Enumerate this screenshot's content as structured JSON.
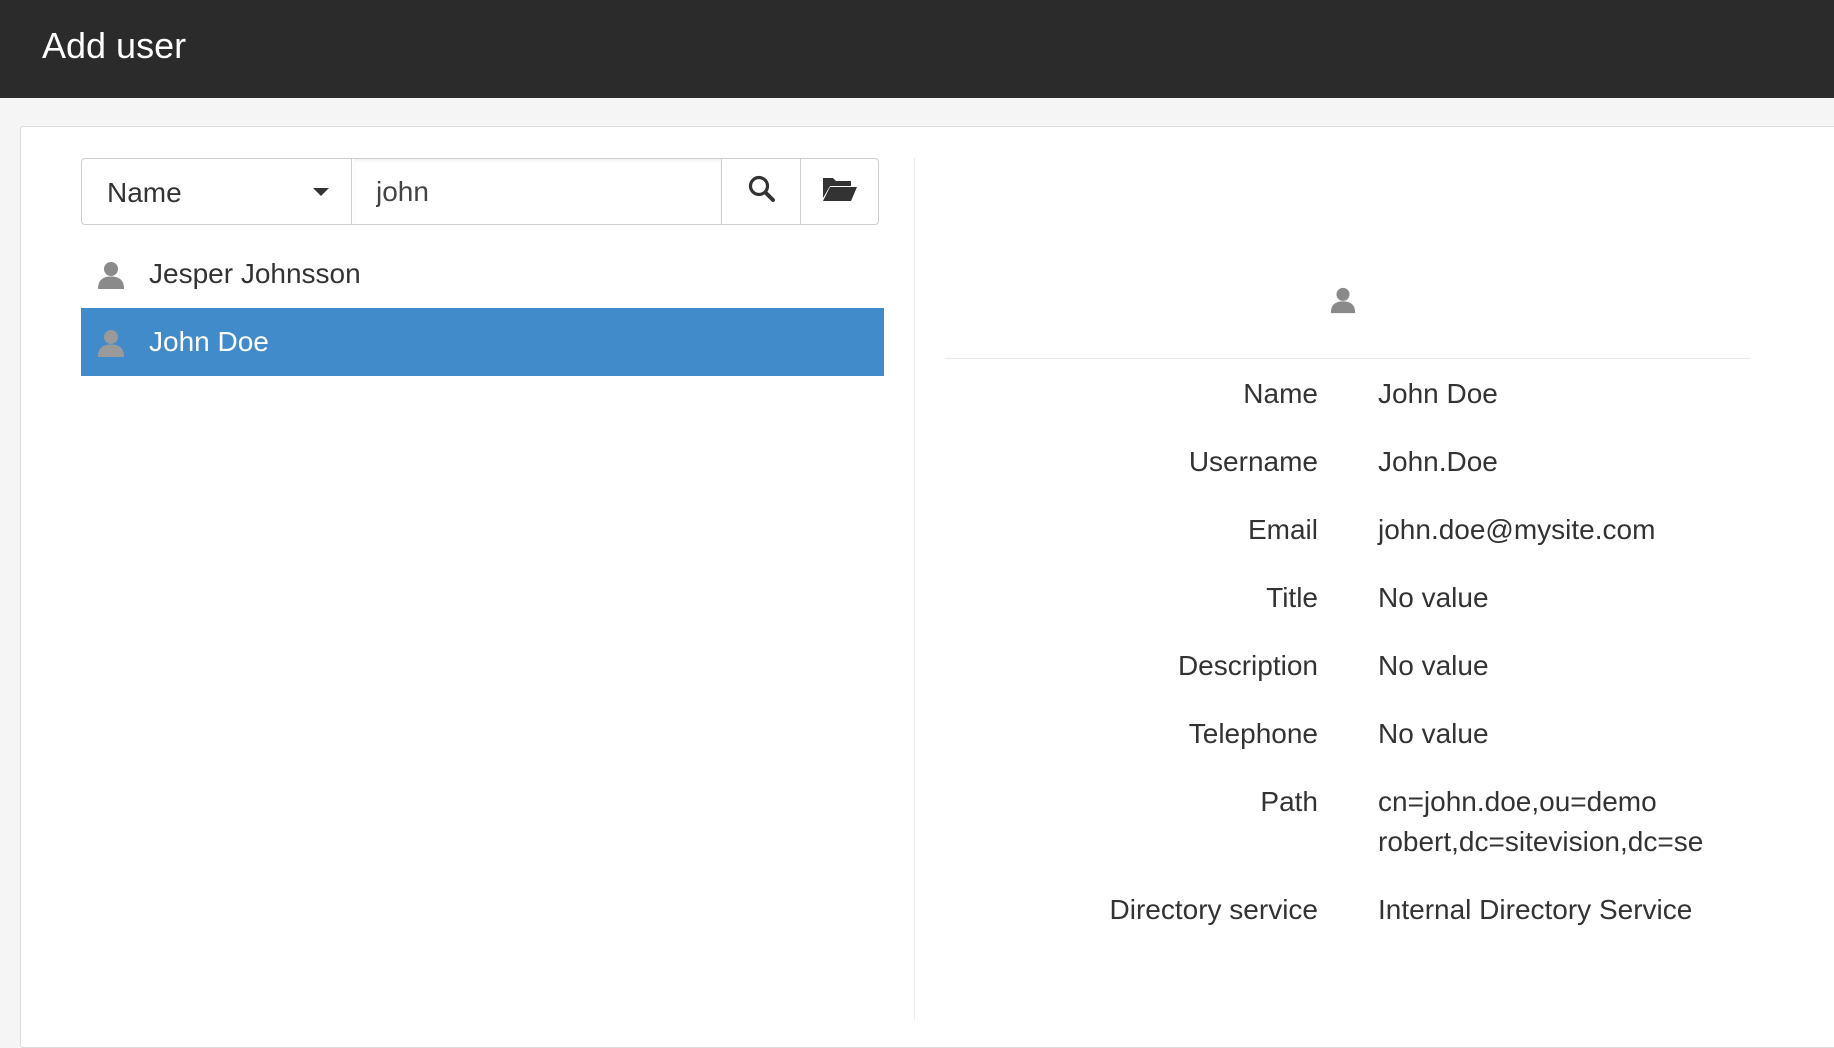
{
  "header": {
    "title": "Add user"
  },
  "search": {
    "field_selected": "Name",
    "query": "john",
    "search_icon": "search-icon",
    "browse_icon": "folder-open-icon"
  },
  "results": [
    {
      "name": "Jesper Johnsson",
      "selected": false,
      "icon": "user-icon"
    },
    {
      "name": "John Doe",
      "selected": true,
      "icon": "user-icon"
    }
  ],
  "details": {
    "avatar_icon": "user-icon",
    "rows": [
      {
        "label": "Name",
        "value": "John Doe"
      },
      {
        "label": "Username",
        "value": "John.Doe"
      },
      {
        "label": "Email",
        "value": "john.doe@mysite.com"
      },
      {
        "label": "Title",
        "value": "No value"
      },
      {
        "label": "Description",
        "value": "No value"
      },
      {
        "label": "Telephone",
        "value": "No value"
      },
      {
        "label": "Path",
        "value": "cn=john.doe,ou=demo\nrobert,dc=sitevision,dc=se"
      },
      {
        "label": "Directory service",
        "value": "Internal Directory Service"
      }
    ]
  },
  "colors": {
    "header_bg": "#2b2b2b",
    "selected_bg": "#428bca",
    "text": "#333333",
    "icon_gray": "#8a8a8a"
  }
}
